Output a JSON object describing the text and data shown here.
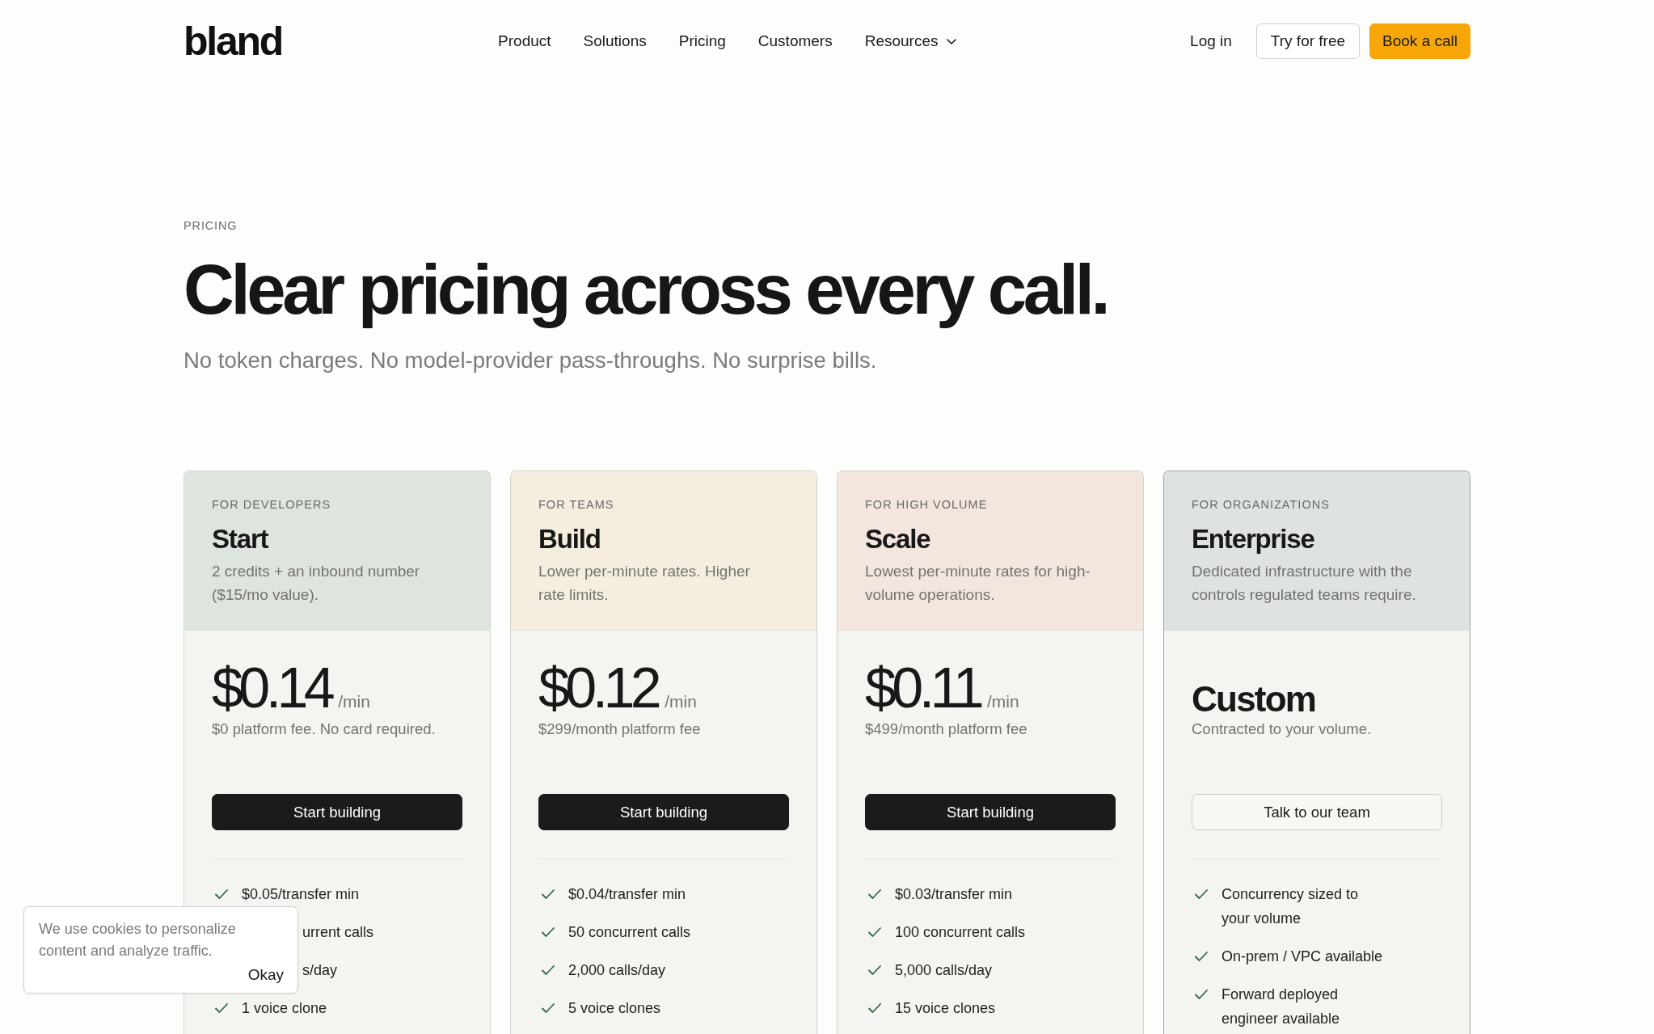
{
  "header": {
    "logo": "bland",
    "nav": [
      {
        "label": "Product",
        "dropdown": false
      },
      {
        "label": "Solutions",
        "dropdown": false
      },
      {
        "label": "Pricing",
        "dropdown": false
      },
      {
        "label": "Customers",
        "dropdown": false
      },
      {
        "label": "Resources",
        "dropdown": true
      }
    ],
    "login": "Log in",
    "buttons": [
      {
        "label": "Try for free",
        "kind": "outline"
      },
      {
        "label": "Book a call",
        "kind": "accent"
      }
    ]
  },
  "hero": {
    "eyebrow": "PRICING",
    "title": "Clear pricing across every call.",
    "subtitle": "No token charges. No model-provider pass-throughs. No surprise bills."
  },
  "plans": [
    {
      "audience": "FOR DEVELOPERS",
      "name": "Start",
      "description": "2 credits + an inbound number ($15/mo value).",
      "color": "#dee5dd",
      "highlighted": false,
      "price": {
        "kind": "rate",
        "amount": "$0.14",
        "unit": "/min"
      },
      "fee": "$0 platform fee. No card required.",
      "button": {
        "label": "Start building",
        "kind": "primary"
      },
      "features": [
        {
          "kind": "check",
          "text": "$0.05/transfer min"
        },
        {
          "kind": "clipped",
          "text": "urrent calls"
        },
        {
          "kind": "clipped",
          "text": "s/day"
        },
        {
          "kind": "check",
          "text": "1 voice clone"
        }
      ]
    },
    {
      "audience": "FOR TEAMS",
      "name": "Build",
      "description": "Lower per-minute rates. Higher rate limits.",
      "color": "#f5eedf",
      "highlighted": false,
      "price": {
        "kind": "rate",
        "amount": "$0.12",
        "unit": "/min"
      },
      "fee": "$299/month platform fee",
      "button": {
        "label": "Start building",
        "kind": "primary"
      },
      "features": [
        {
          "kind": "check",
          "text": "$0.04/transfer min"
        },
        {
          "kind": "check",
          "text": "50 concurrent calls"
        },
        {
          "kind": "check",
          "text": "2,000 calls/day"
        },
        {
          "kind": "check",
          "text": "5 voice clones"
        }
      ]
    },
    {
      "audience": "FOR HIGH VOLUME",
      "name": "Scale",
      "description": "Lowest per-minute rates for high-volume operations.",
      "color": "#f3e6df",
      "highlighted": false,
      "price": {
        "kind": "rate",
        "amount": "$0.11",
        "unit": "/min"
      },
      "fee": "$499/month platform fee",
      "button": {
        "label": "Start building",
        "kind": "primary"
      },
      "features": [
        {
          "kind": "check",
          "text": "$0.03/transfer min"
        },
        {
          "kind": "check",
          "text": "100 concurrent calls"
        },
        {
          "kind": "check",
          "text": "5,000 calls/day"
        },
        {
          "kind": "check",
          "text": "15 voice clones"
        }
      ]
    },
    {
      "audience": "FOR ORGANIZATIONS",
      "name": "Enterprise",
      "description": "Dedicated infrastructure with the controls regulated teams require.",
      "color": "#dfe2e3",
      "highlighted": true,
      "price": {
        "kind": "custom",
        "amount": "Custom"
      },
      "fee": "Contracted to your volume.",
      "button": {
        "label": "Talk to our team",
        "kind": "outline"
      },
      "features": [
        {
          "kind": "check",
          "text": "Concurrency sized to your volume"
        },
        {
          "kind": "check",
          "text": "On-prem / VPC available"
        },
        {
          "kind": "check",
          "text": "Forward deployed engineer available"
        }
      ]
    }
  ],
  "cookie_banner": {
    "message": "We use cookies to personalize content and analyze traffic.",
    "button": "Okay"
  }
}
